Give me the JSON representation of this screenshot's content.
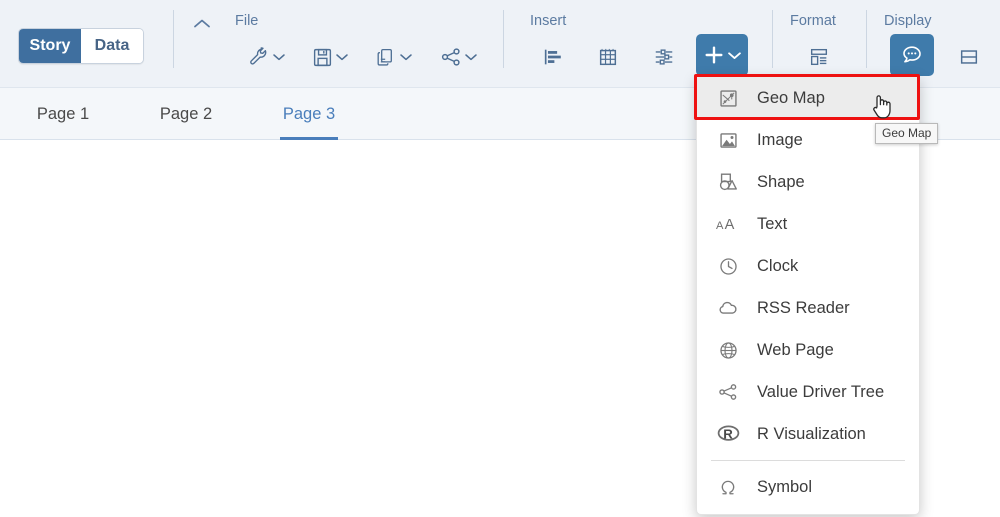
{
  "app": {
    "mode_toggle": {
      "story_label": "Story",
      "data_label": "Data",
      "active": "Story"
    },
    "accent_blue": "#3f7bab",
    "toggle_blue": "#3f6f9f",
    "header_bg": "#eef2f7",
    "tabbar_bg": "#f4f7fa",
    "highlight_color": "#ee1111"
  },
  "toolbar": {
    "collapse_icon": "chevron-up-icon",
    "groups": [
      {
        "label": "File",
        "items": [
          {
            "name": "tools-menu",
            "icon": "wrench-icon",
            "has_chevron": true
          },
          {
            "name": "save-menu",
            "icon": "save-floppy-icon",
            "has_chevron": true
          },
          {
            "name": "copy-menu",
            "icon": "copy-documents-icon",
            "has_chevron": true
          },
          {
            "name": "share-menu",
            "icon": "share-nodes-icon",
            "has_chevron": true
          }
        ]
      },
      {
        "label": "Insert",
        "items": [
          {
            "name": "insert-chart",
            "icon": "bar-chart-icon",
            "has_chevron": false
          },
          {
            "name": "insert-table",
            "icon": "table-grid-icon",
            "has_chevron": false
          },
          {
            "name": "insert-input-control",
            "icon": "sliders-icon",
            "has_chevron": false
          },
          {
            "name": "insert-more",
            "icon": "plus-icon",
            "has_chevron": true,
            "state": "primary"
          }
        ]
      },
      {
        "label": "Format",
        "items": [
          {
            "name": "format-layout",
            "icon": "layout-panel-icon",
            "has_chevron": false
          }
        ]
      },
      {
        "label": "Display",
        "items": [
          {
            "name": "display-comments",
            "icon": "comment-bubble-icon",
            "has_chevron": false,
            "state": "toggled"
          },
          {
            "name": "display-split",
            "icon": "split-panel-icon",
            "has_chevron": false
          }
        ]
      }
    ]
  },
  "tabs": {
    "items": [
      {
        "label": "Page 1",
        "active": false
      },
      {
        "label": "Page 2",
        "active": false
      },
      {
        "label": "Page 3",
        "active": true
      }
    ]
  },
  "insert_menu": {
    "items": [
      {
        "label": "Geo Map",
        "icon": "geo-map-icon",
        "hovered": true,
        "separator_before": false
      },
      {
        "label": "Image",
        "icon": "image-icon",
        "hovered": false,
        "separator_before": false
      },
      {
        "label": "Shape",
        "icon": "shape-icon",
        "hovered": false,
        "separator_before": false
      },
      {
        "label": "Text",
        "icon": "text-aa-icon",
        "hovered": false,
        "separator_before": false
      },
      {
        "label": "Clock",
        "icon": "clock-icon",
        "hovered": false,
        "separator_before": false
      },
      {
        "label": "RSS Reader",
        "icon": "cloud-icon",
        "hovered": false,
        "separator_before": false
      },
      {
        "label": "Web Page",
        "icon": "globe-icon",
        "hovered": false,
        "separator_before": false
      },
      {
        "label": "Value Driver Tree",
        "icon": "value-driver-tree-icon",
        "hovered": false,
        "separator_before": false
      },
      {
        "label": "R Visualization",
        "icon": "r-logo-icon",
        "hovered": false,
        "separator_before": false
      },
      {
        "label": "Symbol",
        "icon": "omega-symbol-icon",
        "hovered": false,
        "separator_before": true
      }
    ]
  },
  "tooltip": {
    "text": "Geo Map"
  }
}
